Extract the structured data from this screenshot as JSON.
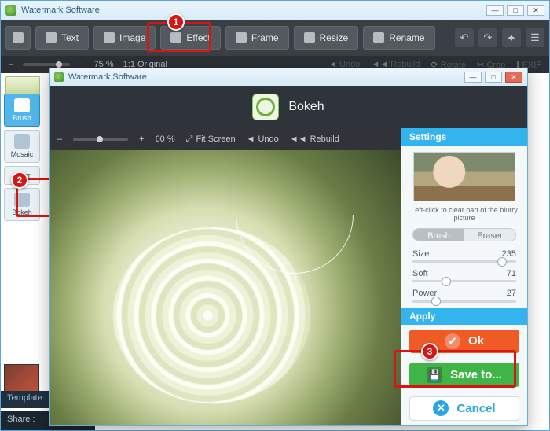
{
  "main_window": {
    "title": "Watermark Software",
    "toolbar": {
      "home": "",
      "text": "Text",
      "image": "Image",
      "effect": "Effect",
      "frame": "Frame",
      "resize": "Resize",
      "rename": "Rename"
    },
    "sub_toolbar": {
      "zoom_pct": "75 %",
      "original": "Original",
      "undo": "Undo",
      "rebuild": "Rebuild",
      "rotate": "Rotate",
      "crop": "Crop",
      "exif": "EXIF"
    },
    "tools": {
      "brush": "Brush",
      "mosaic": "Mosaic",
      "color": "Color",
      "bokeh": "Bokeh"
    },
    "templates_label": "Template",
    "share_label": "Share :"
  },
  "dialog": {
    "title": "Watermark Software",
    "header_title": "Bokeh",
    "canvas_tools": {
      "zoom_pct": "60 %",
      "fit": "Fit Screen",
      "undo": "Undo",
      "rebuild": "Rebuild"
    },
    "settings": {
      "section": "Settings",
      "hint": "Left-click to clear part of the blurry picture",
      "seg_brush": "Brush",
      "seg_eraser": "Eraser",
      "size_label": "Size",
      "size_value": "235",
      "soft_label": "Soft",
      "soft_value": "71",
      "power_label": "Power",
      "power_value": "27",
      "apply_section": "Apply",
      "ok": "Ok",
      "save": "Save to...",
      "cancel": "Cancel"
    }
  },
  "callouts": {
    "one": "1",
    "two": "2",
    "three": "3"
  }
}
